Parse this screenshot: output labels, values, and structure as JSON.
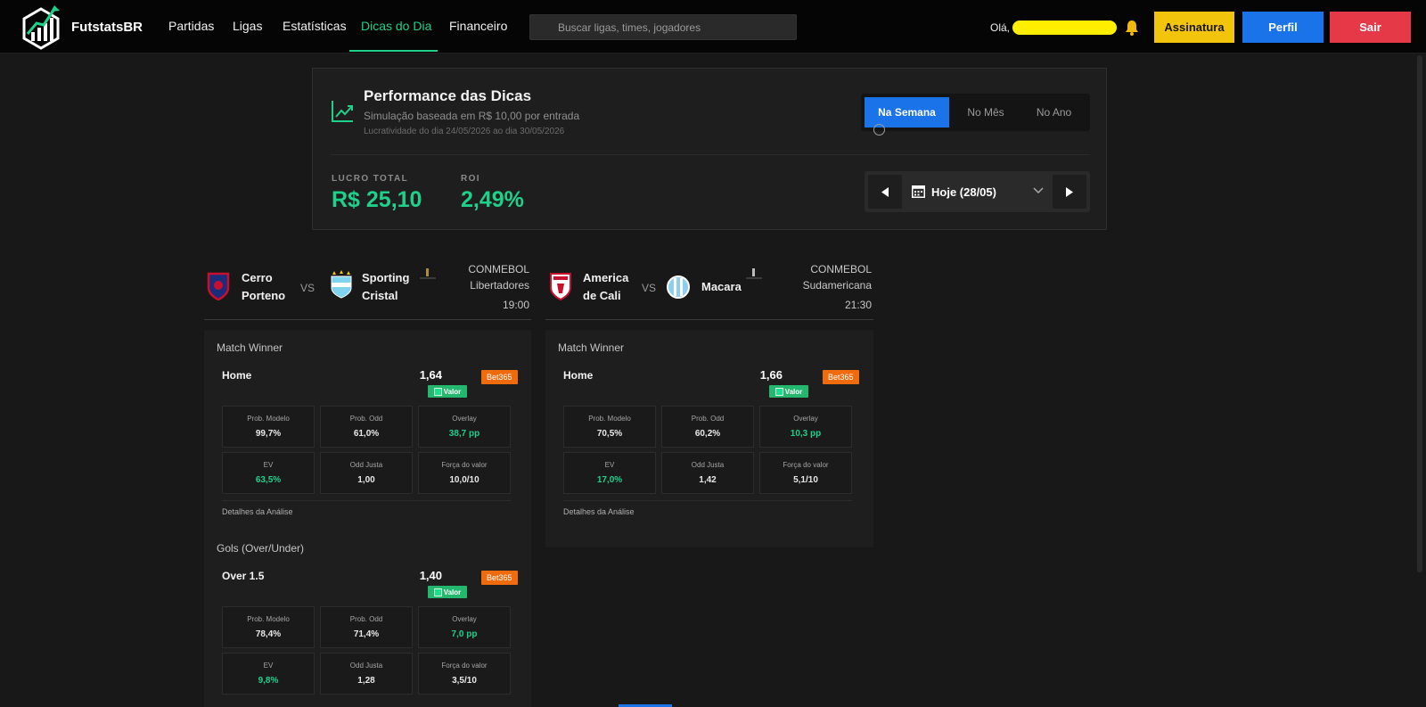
{
  "nav": {
    "brand": "FutstatsBR",
    "links": [
      "Partidas",
      "Ligas",
      "Estatísticas",
      "Dicas do Dia",
      "Financeiro"
    ],
    "active_link": "Dicas do Dia",
    "search_placeholder": "Buscar ligas, times, jogadores",
    "greeting": "Olá,",
    "buttons": {
      "subscription": "Assinatura",
      "profile": "Perfil",
      "logout": "Sair"
    },
    "colors": {
      "active": "#1fd08a",
      "subscription": "#f2c40c",
      "profile": "#1a73e8",
      "logout": "#e53947"
    }
  },
  "performance": {
    "title": "Performance das Dicas",
    "subtitle": "Simulação baseada em R$ 10,00 por entrada",
    "period": "Lucratividade do dia 24/05/2026 ao dia 30/05/2026",
    "tabs": [
      "Na Semana",
      "No Mês",
      "No Ano"
    ],
    "active_tab": "Na Semana",
    "profit_label": "LUCRO TOTAL",
    "profit_value": "R$ 25,10",
    "roi_label": "ROI",
    "roi_value": "2,49%",
    "date_label": "Hoje (28/05)"
  },
  "matches": [
    {
      "home": [
        "Cerro",
        "Porteno"
      ],
      "vs": "VS",
      "away": [
        "Sporting",
        "Cristal"
      ],
      "league": [
        "CONMEBOL",
        "Libertadores"
      ],
      "time": "19:00",
      "sections": [
        {
          "title": "Match Winner",
          "bet": "Home",
          "odd": "1,64",
          "bookmaker": "Bet365",
          "badge": "Valor",
          "cells": [
            {
              "label": "Prob. Modelo",
              "value": "99,7%"
            },
            {
              "label": "Prob. Odd",
              "value": "61,0%"
            },
            {
              "label": "Overlay",
              "value": "38,7 pp"
            },
            {
              "label": "EV",
              "value": "63,5%"
            },
            {
              "label": "Odd Justa",
              "value": "1,00"
            },
            {
              "label": "Força do valor",
              "value": "10,0/10"
            }
          ],
          "details": "Detalhes da Análise"
        },
        {
          "title": "Gols (Over/Under)",
          "bet": "Over 1.5",
          "odd": "1,40",
          "bookmaker": "Bet365",
          "badge": "Valor",
          "cells": [
            {
              "label": "Prob. Modelo",
              "value": "78,4%"
            },
            {
              "label": "Prob. Odd",
              "value": "71,4%"
            },
            {
              "label": "Overlay",
              "value": "7,0 pp"
            },
            {
              "label": "EV",
              "value": "9,8%"
            },
            {
              "label": "Odd Justa",
              "value": "1,28"
            },
            {
              "label": "Força do valor",
              "value": "3,5/10"
            }
          ]
        }
      ]
    },
    {
      "home": [
        "America",
        "de Cali"
      ],
      "vs": "VS",
      "away": [
        "Macara"
      ],
      "league": [
        "CONMEBOL",
        "Sudamericana"
      ],
      "time": "21:30",
      "sections": [
        {
          "title": "Match Winner",
          "bet": "Home",
          "odd": "1,66",
          "bookmaker": "Bet365",
          "badge": "Valor",
          "cells": [
            {
              "label": "Prob. Modelo",
              "value": "70,5%"
            },
            {
              "label": "Prob. Odd",
              "value": "60,2%"
            },
            {
              "label": "Overlay",
              "value": "10,3 pp"
            },
            {
              "label": "EV",
              "value": "17,0%"
            },
            {
              "label": "Odd Justa",
              "value": "1,42"
            },
            {
              "label": "Força do valor",
              "value": "5,1/10"
            }
          ],
          "details": "Detalhes da Análise"
        }
      ]
    }
  ]
}
